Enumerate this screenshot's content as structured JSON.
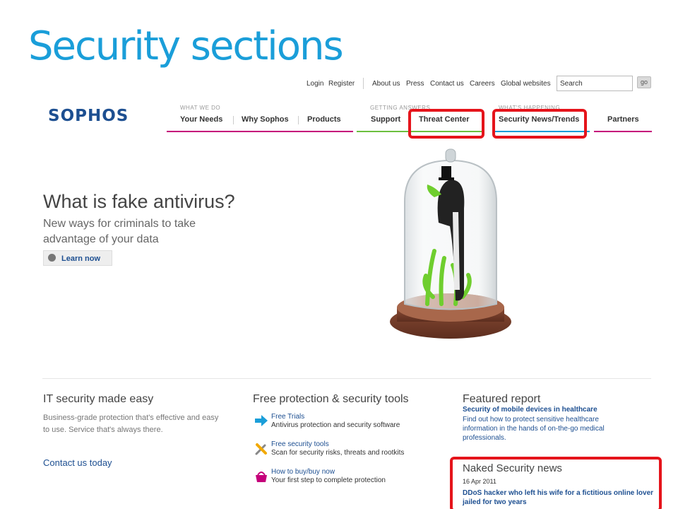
{
  "slide": {
    "title": "Security sections"
  },
  "utility": {
    "links": [
      "Login",
      "Register",
      "About us",
      "Press",
      "Contact us",
      "Careers",
      "Global websites"
    ],
    "search_value": "Search",
    "go_label": "go"
  },
  "logo": {
    "text": "SOPHOS"
  },
  "nav": {
    "groups": [
      {
        "label": "WHAT WE DO",
        "items": [
          "Your Needs",
          "Why Sophos",
          "Products"
        ],
        "color": "#c5007a"
      },
      {
        "label": "GETTING ANSWERS",
        "items": [
          "Support",
          "Threat Center"
        ],
        "color": "#6cbf3f"
      },
      {
        "label": "WHAT'S HAPPENING",
        "items": [
          "Security News/Trends"
        ],
        "color": "#1a9ed9"
      },
      {
        "label": "",
        "items": [
          "Partners"
        ],
        "color": "#c5007a"
      }
    ]
  },
  "hero": {
    "title": "What is fake antivirus?",
    "subtitle": "New ways for criminals to take advantage of your data",
    "button_label": "Learn now"
  },
  "columns": {
    "it_security": {
      "heading": "IT security made easy",
      "text": "Business-grade protection that's effective and easy to use. Service that's always there.",
      "link": "Contact us today"
    },
    "free_tools": {
      "heading": "Free protection & security tools",
      "items": [
        {
          "icon": "arrow-right-icon",
          "title": "Free Trials",
          "desc": "Antivirus protection and security software"
        },
        {
          "icon": "tools-icon",
          "title": "Free security tools",
          "desc": "Scan for security risks, threats and rootkits"
        },
        {
          "icon": "basket-icon",
          "title": "How to buy/buy now",
          "desc": "Your first step to complete protection"
        }
      ]
    },
    "featured": {
      "heading": "Featured report",
      "title": "Security of mobile devices in healthcare",
      "desc": "Find out how to protect sensitive healthcare information in the hands of on-the-go medical professionals."
    },
    "news": {
      "heading": "Naked Security news",
      "date": "16 Apr 2011",
      "link": "DDoS hacker who left his wife for a fictitious online lover jailed for two years"
    }
  },
  "colors": {
    "accent": "#1a9ed9",
    "brand": "#1d4f91",
    "highlight": "#e5141b"
  }
}
